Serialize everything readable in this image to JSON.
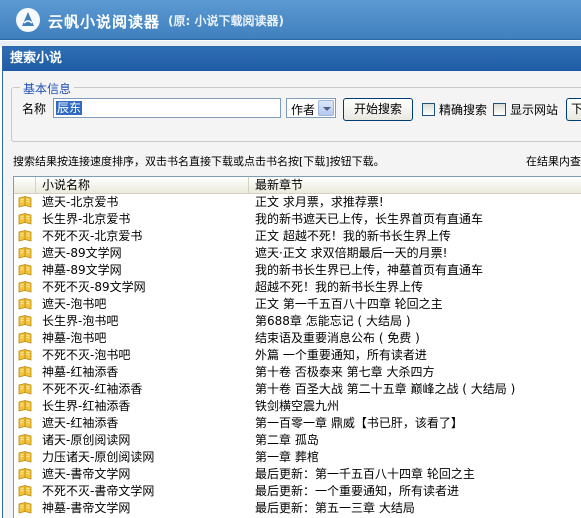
{
  "app": {
    "title": "云帆小说阅读器",
    "subtitle": "(原: 小说下载阅读器)"
  },
  "panel": {
    "title": "搜索小说"
  },
  "basic_info": {
    "legend": "基本信息",
    "name_label": "名称",
    "name_value": "辰东",
    "search_type": "作者",
    "search_button": "开始搜索",
    "exact_label": "精确搜索",
    "show_site_label": "显示网站",
    "next_button": "下"
  },
  "hint_text": "搜索结果按连接速度排序，双击书名直接下载或点击书名按[下载]按钮下载。",
  "hint_right": "在结果内查",
  "table": {
    "col_name": "小说名称",
    "col_chapter": "最新章节",
    "rows": [
      {
        "name": "遮天-北京爱书",
        "chapter": "正文 求月票，求推荐票!"
      },
      {
        "name": "长生界-北京爱书",
        "chapter": "我的新书遮天已上传，长生界首页有直通车"
      },
      {
        "name": "不死不灭-北京爱书",
        "chapter": "正文 超越不死！我的新书长生界上传"
      },
      {
        "name": "遮天-89文学网",
        "chapter": "遮天·正文 求双倍期最后一天的月票!"
      },
      {
        "name": "神墓-89文学网",
        "chapter": "我的新书长生界已上传，神墓首页有直通车"
      },
      {
        "name": "不死不灭-89文学网",
        "chapter": "超越不死！我的新书长生界上传"
      },
      {
        "name": "遮天-泡书吧",
        "chapter": "正文 第一千五百八十四章 轮回之主"
      },
      {
        "name": "长生界-泡书吧",
        "chapter": "第688章 怎能忘记 ( 大结局 )"
      },
      {
        "name": "神墓-泡书吧",
        "chapter": "结束语及重要消息公布 ( 免费 )"
      },
      {
        "name": "不死不灭-泡书吧",
        "chapter": "外篇 一个重要通知，所有读者进"
      },
      {
        "name": "神墓-红袖添香",
        "chapter": "第十卷 否极泰来 第七章 大杀四方"
      },
      {
        "name": "不死不灭-红袖添香",
        "chapter": "第十卷 百圣大战 第二十五章 巅峰之战 ( 大结局 )"
      },
      {
        "name": "长生界-红袖添香",
        "chapter": "铁剑横空震九州"
      },
      {
        "name": "遮天-红袖添香",
        "chapter": "第一百零一章 鼎威【书已肝，该看了】"
      },
      {
        "name": "诸天-原创阅读网",
        "chapter": "第二章 孤岛"
      },
      {
        "name": "力压诸天-原创阅读网",
        "chapter": "第一章 葬棺"
      },
      {
        "name": "遮天-書帝文学网",
        "chapter": "最后更新：第一千五百八十四章 轮回之主"
      },
      {
        "name": "不死不灭-書帝文学网",
        "chapter": "最后更新：一个重要通知，所有读者进"
      },
      {
        "name": "神墓-書帝文学网",
        "chapter": "最后更新：第五一三章 大结局"
      }
    ]
  }
}
